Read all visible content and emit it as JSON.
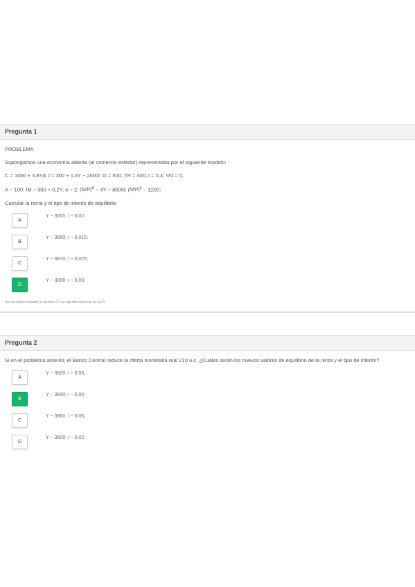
{
  "q1": {
    "title": "Pregunta 1",
    "label": "PROBLEMA",
    "intro": "Supongamos una economía abierta (al comercio exterior) representada por el siguiente modelo:",
    "model_line1": "C = 1050 + 0,8Yd; I = 300 + 0,3Y − 2000i; G = 500; TR = 400; t = 0,4; Ψd = 0;",
    "model_line2_a": "X − 100; IM − 300 + 0,2Y; e − 2;",
    "model_line2_b": "− 4Y − 8000i;",
    "model_line2_c": "− 1200;",
    "frac1": "(M/P)",
    "frac1_exp": "d",
    "frac2": "(M/P)",
    "frac2_exp": "s",
    "question": "Calcular la renta y el tipo de interés de equilibrio.",
    "options": [
      {
        "letter": "A",
        "text": "Y − 3000; i − 0,02;"
      },
      {
        "letter": "B",
        "text": "Y − 3850; i − 0,015;"
      },
      {
        "letter": "C",
        "text": "Y − 3870; i − 0,025;"
      },
      {
        "letter": "D",
        "text": "Y − 3000; i − 0,03;"
      }
    ],
    "selected": "D",
    "feedback": "Se ha seleccionado la opción D. La opción correcta es la D."
  },
  "q2": {
    "title": "Pregunta 2",
    "question": "Si en el problema anterior, el Banco Central reduce la oferta monetaria real 210 u.c. ¿Cuáles serán los nuevos valores de equilibrio de la renta y el tipo de interés?",
    "options": [
      {
        "letter": "A",
        "text": "Y − 3820; i − 0,03;"
      },
      {
        "letter": "B",
        "text": "Y − 3840; i − 0,04;"
      },
      {
        "letter": "C",
        "text": "Y − 3860; i − 0,05;"
      },
      {
        "letter": "D",
        "text": "Y − 3800; i − 0,02;"
      }
    ],
    "selected": "B"
  },
  "colors": {
    "selected": "#1ab46a"
  }
}
